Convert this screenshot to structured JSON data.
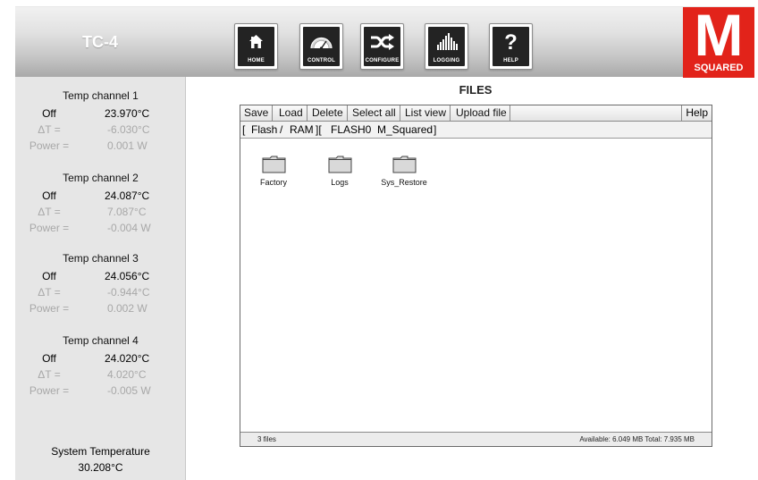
{
  "header": {
    "title": "TC-4",
    "nav": [
      {
        "label": "HOME",
        "icon": "home-icon"
      },
      {
        "label": "CONTROL",
        "icon": "gauge-icon"
      },
      {
        "label": "CONFIGURE",
        "icon": "shuffle-icon"
      },
      {
        "label": "LOGGING",
        "icon": "bar-chart-icon"
      },
      {
        "label": "HELP",
        "icon": "question-icon"
      }
    ],
    "logo": {
      "letter": "M",
      "text": "SQUARED",
      "color": "#e2231a"
    }
  },
  "sidebar": {
    "channels": [
      {
        "title": "Temp channel 1",
        "state": "Off",
        "temp": "23.970°C",
        "delta_label": "ΔT =",
        "delta": "-6.030°C",
        "power_label": "Power =",
        "power": "0.001 W"
      },
      {
        "title": "Temp channel 2",
        "state": "Off",
        "temp": "24.087°C",
        "delta_label": "ΔT =",
        "delta": "7.087°C",
        "power_label": "Power =",
        "power": "-0.004 W"
      },
      {
        "title": "Temp channel 3",
        "state": "Off",
        "temp": "24.056°C",
        "delta_label": "ΔT =",
        "delta": "-0.944°C",
        "power_label": "Power =",
        "power": "0.002 W"
      },
      {
        "title": "Temp channel 4",
        "state": "Off",
        "temp": "24.020°C",
        "delta_label": "ΔT =",
        "delta": "4.020°C",
        "power_label": "Power =",
        "power": "-0.005 W"
      }
    ],
    "system_temp_label": "System Temperature",
    "system_temp": "30.208°C"
  },
  "main": {
    "title": "FILES",
    "toolbar": [
      "Save",
      "Load",
      "Delete",
      "Select all",
      "List view",
      "Upload file"
    ],
    "help": "Help",
    "path": {
      "open1": "[",
      "flash": "Flash",
      "sep": "/",
      "ram": "RAM",
      "close1": "][",
      "drive": "FLASH0",
      "folder": "M_Squared",
      "close2": "]"
    },
    "folders": [
      {
        "name": "Factory"
      },
      {
        "name": "Logs"
      },
      {
        "name": "Sys_Restore"
      }
    ],
    "status": {
      "count": "3 files",
      "space": "Available: 6.049 MB Total: 7.935 MB"
    }
  }
}
